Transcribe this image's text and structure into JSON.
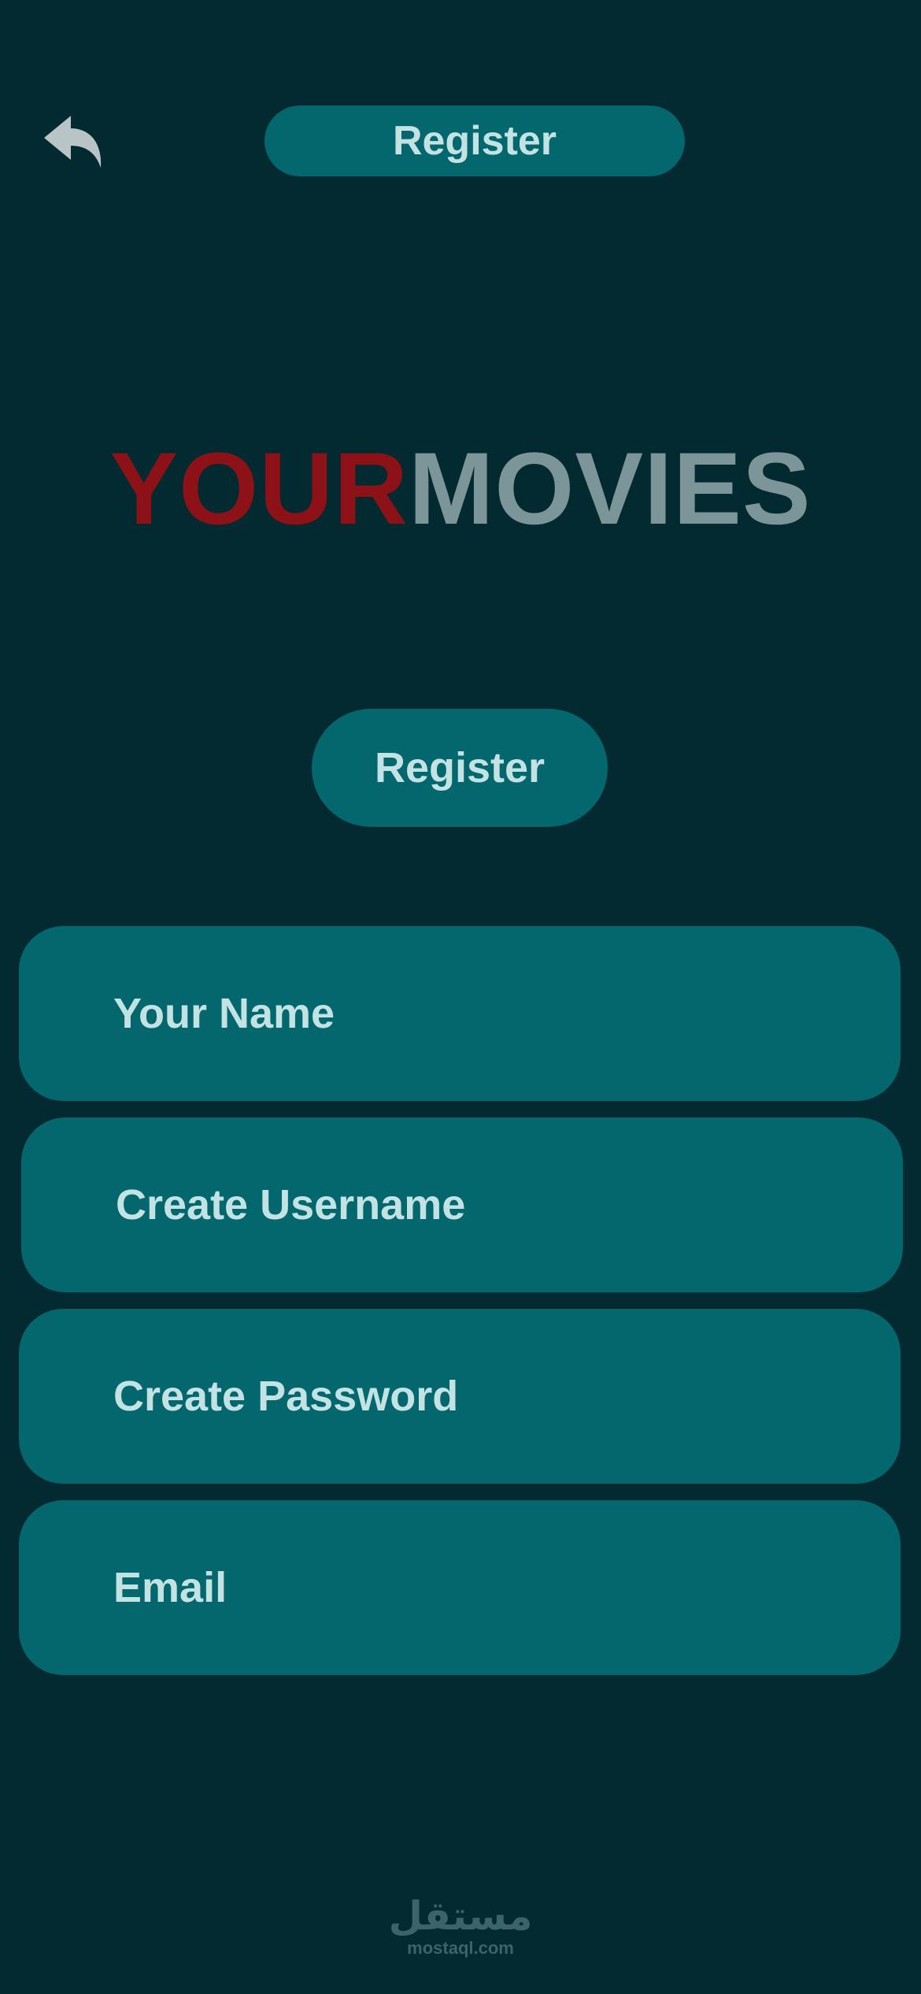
{
  "header": {
    "back_icon": "reply-arrow-icon",
    "title": "Register"
  },
  "logo": {
    "part1": "YOUR",
    "part2": "MOVIES",
    "part1_color": "#8c1217",
    "part2_color": "#7c9599"
  },
  "register_button": {
    "label": "Register"
  },
  "form": {
    "fields": [
      {
        "placeholder": "Your Name"
      },
      {
        "placeholder": "Create Username"
      },
      {
        "placeholder": "Create Password"
      },
      {
        "placeholder": "Email"
      }
    ]
  },
  "watermark": {
    "mark": "مستقل",
    "domain": "mostaql.com"
  },
  "colors": {
    "background": "#022a30",
    "accent": "#03676d",
    "text": "#c3e2e3"
  }
}
